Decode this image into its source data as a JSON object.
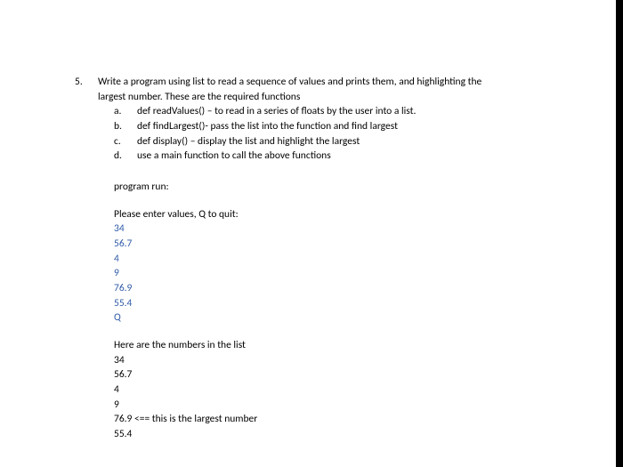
{
  "question": {
    "number": "5.",
    "prompt_line1": "Write a program using list to read a sequence of values and prints them, and highlighting the",
    "prompt_line2": "largest number.  These are the required functions",
    "subs": [
      {
        "letter": "a.",
        "text": "def readValues() – to read in a series of floats by the user into a list."
      },
      {
        "letter": "b.",
        "text": "def findLargest()- pass the list into the function and find largest"
      },
      {
        "letter": "c.",
        "text": "def display() – display the list and highlight the largest"
      },
      {
        "letter": "d.",
        "text": "use a main function to call the above functions"
      }
    ]
  },
  "run": {
    "label": "program run:",
    "prompt": "Please enter values, Q to quit:",
    "inputs": [
      "34",
      "56.7",
      "4",
      "9",
      "76.9",
      "55.4",
      "Q"
    ],
    "result_heading": "Here are the numbers in the list",
    "results": [
      {
        "text": "34"
      },
      {
        "text": "56.7"
      },
      {
        "text": "4"
      },
      {
        "text": "9"
      },
      {
        "text": "76.9 <== this is the largest number"
      },
      {
        "text": "55.4"
      }
    ]
  }
}
